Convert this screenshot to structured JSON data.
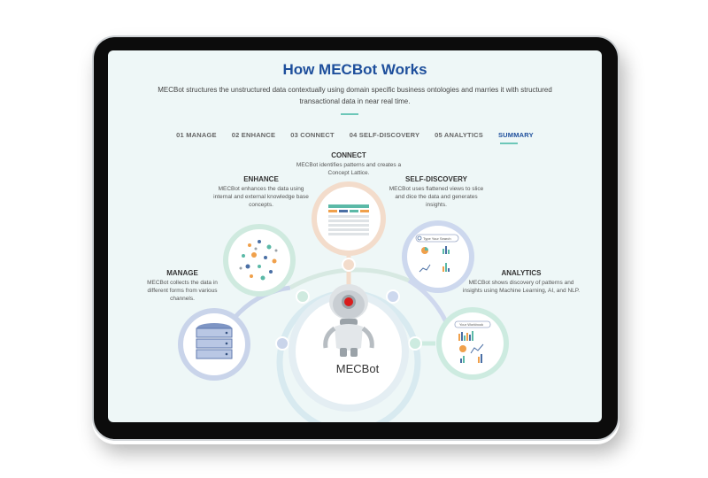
{
  "page": {
    "title": "How MECBot Works",
    "subtitle": "MECBot structures the unstructured data contextually using domain specific business ontologies and marries it with structured transactional data in near real time."
  },
  "tabs": [
    {
      "label": "01 MANAGE",
      "active": false
    },
    {
      "label": "02 ENHANCE",
      "active": false
    },
    {
      "label": "03 CONNECT",
      "active": false
    },
    {
      "label": "04 SELF-DISCOVERY",
      "active": false
    },
    {
      "label": "05 ANALYTICS",
      "active": false
    },
    {
      "label": "SUMMARY",
      "active": true
    }
  ],
  "steps": {
    "manage": {
      "title": "MANAGE",
      "desc": "MECBot collects the data in different forms from various channels.",
      "icon": "database-icon"
    },
    "enhance": {
      "title": "ENHANCE",
      "desc": "MECBot enhances the data using internal and external knowledge base concepts.",
      "icon": "scatter-dots-icon"
    },
    "connect": {
      "title": "CONNECT",
      "desc": "MECBot identifies patterns and creates a Concept Lattice.",
      "icon": "lattice-grid-icon"
    },
    "self_discovery": {
      "title": "SELF-DISCOVERY",
      "desc": "MECBot uses flattened views to slice and dice the data and generates insights.",
      "icon": "dashboard-search-icon",
      "search_text": "Type Your Search"
    },
    "analytics": {
      "title": "ANALYTICS",
      "desc": "MECBot shows discovery of patterns and insights using Machine Learning, AI, and NLP.",
      "icon": "analytics-report-icon",
      "search_text": "Your Workbook"
    }
  },
  "center": {
    "name": "MECBot",
    "icon": "robot-icon"
  },
  "colors": {
    "title": "#1e4f9c",
    "accent": "#6cc7b8",
    "manage_ring": "#c9d4ea",
    "enhance_ring": "#cfeadf",
    "connect_ring": "#f3dccb",
    "selfdiscovery_ring": "#cdd8ee",
    "analytics_ring": "#cdebe0"
  }
}
